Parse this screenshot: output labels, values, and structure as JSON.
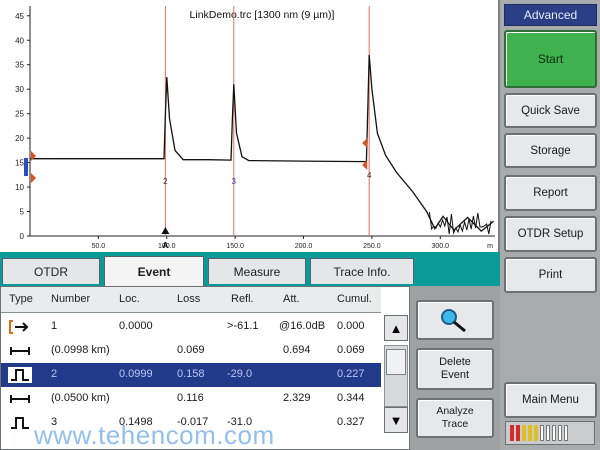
{
  "trace": {
    "title": "LinkDemo.trc [1300 nm (9 µm)]",
    "y_ticks": [
      "45",
      "40",
      "35",
      "30",
      "25",
      "20",
      "15",
      "10",
      "5",
      "0"
    ],
    "x_ticks": [
      "50.0",
      "100.0",
      "150.0",
      "200.0",
      "250.0",
      "300.0"
    ],
    "x_unit": "m",
    "event_markers": [
      "2",
      "3",
      "4"
    ],
    "cursor_label": "A"
  },
  "sidebar": {
    "mode_label": "Advanced",
    "buttons": [
      "Start",
      "Quick Save",
      "Storage",
      "Report",
      "OTDR Setup",
      "Print",
      "Main Menu"
    ],
    "start_color": "#3fb14f"
  },
  "tabs": [
    {
      "label": "OTDR",
      "active": false
    },
    {
      "label": "Event",
      "active": true
    },
    {
      "label": "Measure",
      "active": false
    },
    {
      "label": "Trace Info.",
      "active": false
    }
  ],
  "events_table": {
    "columns": [
      "Type",
      "Number",
      "Loc.",
      "Loss",
      "Refl.",
      "Att.",
      "Cumul."
    ],
    "rows": [
      {
        "type": "launch",
        "number": "1",
        "loc": "0.0000",
        "loss": "",
        "refl": ">-61.1",
        "att": "@16.0dB",
        "cumul": "0.000",
        "selected": false
      },
      {
        "type": "span",
        "number": "(0.0998 km)",
        "loc": "",
        "loss": "0.069",
        "refl": "",
        "att": "0.694",
        "cumul": "0.069",
        "selected": false
      },
      {
        "type": "reflective",
        "number": "2",
        "loc": "0.0999",
        "loss": "0.158",
        "refl": "-29.0",
        "att": "",
        "cumul": "0.227",
        "selected": true
      },
      {
        "type": "span",
        "number": "(0.0500 km)",
        "loc": "",
        "loss": "0.116",
        "refl": "",
        "att": "2.329",
        "cumul": "0.344",
        "selected": false
      },
      {
        "type": "reflective",
        "number": "3",
        "loc": "0.1498",
        "loss": "-0.017",
        "refl": "-31.0",
        "att": "",
        "cumul": "0.327",
        "selected": false
      }
    ]
  },
  "actions": {
    "zoom_icon": "magnifier-icon",
    "delete_event": "Delete Event",
    "analyze_trace": "Analyze Trace"
  },
  "watermark": "www.tehencom.com",
  "chart_data": {
    "type": "line",
    "title": "LinkDemo.trc [1300 nm (9 µm)]",
    "xlabel": "",
    "ylabel": "",
    "xlim": [
      0,
      340
    ],
    "ylim": [
      0,
      47
    ],
    "grid": false,
    "series": [
      {
        "x": [
          0,
          98,
          99,
          100,
          102,
          106,
          112,
          130,
          147,
          148,
          149,
          151,
          155,
          160,
          200,
          246,
          247,
          248,
          250,
          254,
          260,
          268,
          280,
          290,
          296,
          302,
          310,
          320,
          330,
          339
        ],
        "y": [
          15.8,
          15.8,
          25,
          32.5,
          24,
          17.5,
          15.6,
          15.6,
          15.5,
          24,
          31,
          21,
          16.2,
          15.4,
          15.3,
          15.2,
          26,
          37,
          30,
          21,
          16.5,
          13,
          9,
          5,
          1.5,
          4,
          1.2,
          3.8,
          1,
          3
        ]
      }
    ]
  }
}
